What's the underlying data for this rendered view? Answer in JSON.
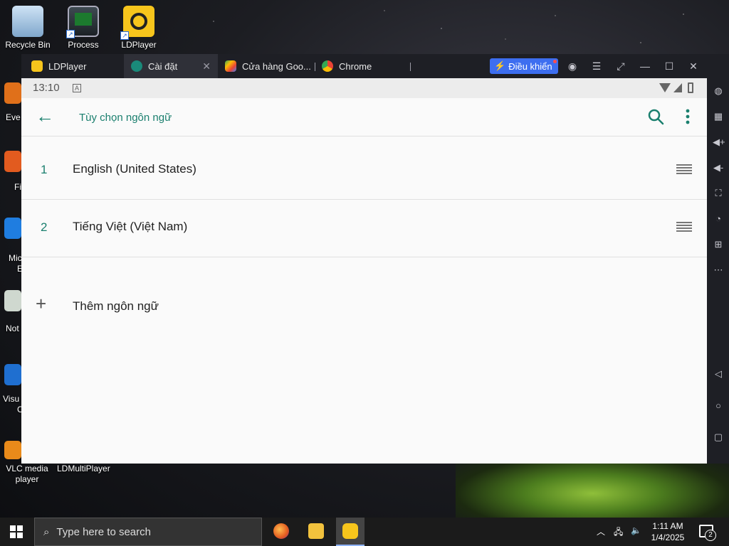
{
  "desktop": {
    "icons": [
      {
        "label": "Recycle Bin"
      },
      {
        "label": "Process"
      },
      {
        "label": "LDPlayer"
      }
    ],
    "partial_labels": [
      "Eve",
      "Fi",
      "Mic",
      "E",
      "Not",
      "Visu",
      "C"
    ],
    "bottom_icons": [
      {
        "label": "VLC media player"
      },
      {
        "label": "LDMultiPlayer"
      }
    ]
  },
  "emulator": {
    "tabs": [
      {
        "label": "LDPlayer",
        "icon": "ldplayer-icon"
      },
      {
        "label": "Cài đặt",
        "icon": "settings-gear-icon",
        "active": true
      },
      {
        "label": "Cửa hàng Goo...",
        "icon": "play-store-icon"
      },
      {
        "label": "Chrome",
        "icon": "chrome-icon"
      }
    ],
    "control_button": "Điều khiển",
    "status_bar": {
      "time": "13:10"
    },
    "app_bar": {
      "title": "Tùy chọn ngôn ngữ"
    },
    "languages": [
      {
        "index": "1",
        "name": "English (United States)"
      },
      {
        "index": "2",
        "name": "Tiếng Việt (Việt Nam)"
      }
    ],
    "add_language": "Thêm ngôn ngữ"
  },
  "taskbar": {
    "search_placeholder": "Type here to search",
    "clock_time": "1:11 AM",
    "clock_date": "1/4/2025",
    "notification_count": "2"
  },
  "colors": {
    "accent": "#1a7f6e",
    "control_button": "#3d6ef0",
    "ldplayer_yellow": "#f7c51c"
  }
}
